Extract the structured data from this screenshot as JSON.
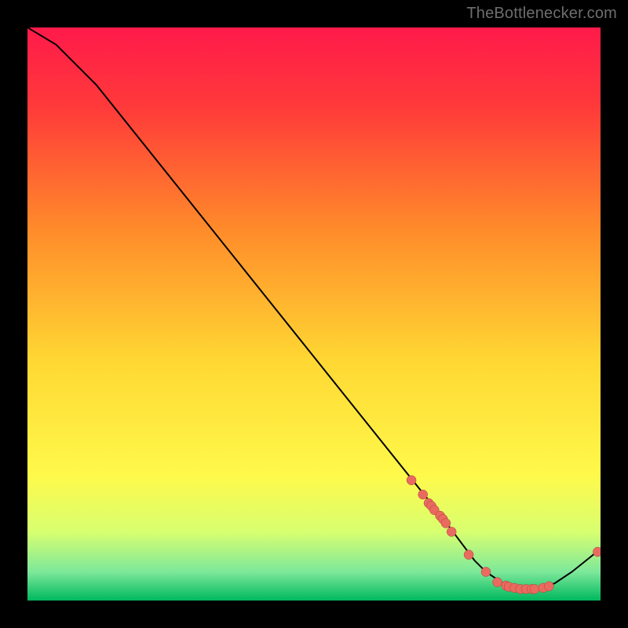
{
  "watermark": "TheBottlenecker.com",
  "colors": {
    "background_black": "#000000",
    "gradient_top": "#ff1a4a",
    "gradient_mid1": "#ff7a2a",
    "gradient_mid2": "#ffe733",
    "gradient_mid3": "#e8ff66",
    "gradient_bot": "#00c36a",
    "curve": "#000000",
    "dot_fill": "#e96a5f",
    "dot_stroke": "#b04038",
    "watermark_text": "#6e6e6e"
  },
  "chart_data": {
    "type": "line",
    "title": "",
    "xlabel": "",
    "ylabel": "",
    "xlim": [
      0,
      100
    ],
    "ylim": [
      0,
      100
    ],
    "grid": false,
    "series": [
      {
        "name": "bottleneck-curve",
        "x": [
          0,
          5,
          8,
          12,
          20,
          30,
          40,
          50,
          60,
          68,
          72,
          75,
          78,
          80,
          83,
          86,
          89,
          92,
          95,
          100
        ],
        "y": [
          100,
          97,
          94,
          90,
          80,
          67.5,
          55,
          42.5,
          30,
          20,
          15,
          11,
          7,
          5,
          3,
          2,
          2,
          3,
          5,
          9
        ]
      }
    ],
    "scatter_points": {
      "name": "highlighted-region",
      "x": [
        67,
        69,
        70,
        70.5,
        71,
        72,
        72.5,
        73,
        74,
        77,
        80,
        82,
        83.5,
        84,
        85,
        86,
        87,
        88,
        88.5,
        90,
        91,
        99.5
      ],
      "y": [
        21,
        18.5,
        17,
        16.5,
        15.8,
        14.8,
        14.2,
        13.5,
        12,
        8,
        5,
        3.2,
        2.6,
        2.4,
        2.2,
        2,
        2,
        2,
        2,
        2.2,
        2.5,
        8.5
      ]
    }
  }
}
